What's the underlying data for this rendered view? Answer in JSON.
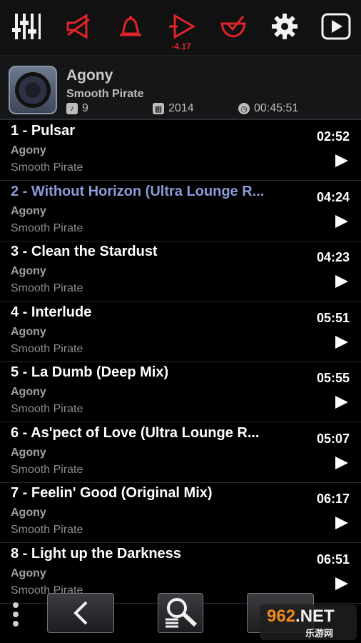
{
  "toolbar": {
    "buttons": [
      {
        "name": "equalizer-icon"
      },
      {
        "name": "volume-icon"
      },
      {
        "name": "bell-icon"
      },
      {
        "name": "play-gain-icon"
      },
      {
        "name": "check-bowl-icon"
      },
      {
        "name": "gear-icon"
      },
      {
        "name": "play-box-icon"
      }
    ],
    "gain_value": "-4.17",
    "accent_color": "#e0242a"
  },
  "album": {
    "title": "Agony",
    "artist": "Smooth Pirate",
    "track_count": "9",
    "year": "2014",
    "duration": "00:45:51"
  },
  "tracks": [
    {
      "title": "1 - Pulsar",
      "album": "Agony",
      "artist": "Smooth Pirate",
      "duration": "02:52",
      "active": false
    },
    {
      "title": "2 - Without Horizon (Ultra Lounge R...",
      "album": "Agony",
      "artist": "Smooth Pirate",
      "duration": "04:24",
      "active": true
    },
    {
      "title": "3 - Clean the Stardust",
      "album": "Agony",
      "artist": "Smooth Pirate",
      "duration": "04:23",
      "active": false
    },
    {
      "title": "4 - Interlude",
      "album": "Agony",
      "artist": "Smooth Pirate",
      "duration": "05:51",
      "active": false
    },
    {
      "title": "5 - La Dumb (Deep Mix)",
      "album": "Agony",
      "artist": "Smooth Pirate",
      "duration": "05:55",
      "active": false
    },
    {
      "title": "6 - As'pect of Love  (Ultra Lounge R...",
      "album": "Agony",
      "artist": "Smooth Pirate",
      "duration": "05:07",
      "active": false
    },
    {
      "title": "7 - Feelin' Good  (Original Mix)",
      "album": "Agony",
      "artist": "Smooth Pirate",
      "duration": "06:17",
      "active": false
    },
    {
      "title": "8 - Light up the Darkness",
      "album": "Agony",
      "artist": "Smooth Pirate",
      "duration": "06:51",
      "active": false
    }
  ],
  "watermark": {
    "brand": "962.NET",
    "sub": "乐游网"
  }
}
